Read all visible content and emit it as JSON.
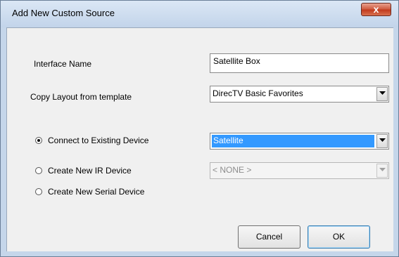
{
  "window": {
    "title": "Add New Custom Source",
    "close_glyph": "x"
  },
  "fields": {
    "interface_name_label": "Interface Name",
    "interface_name_value": "Satellite Box",
    "copy_layout_label": "Copy Layout from template",
    "copy_layout_value": "DirecTV Basic Favorites"
  },
  "options": {
    "connect_existing_label": "Connect to Existing Device",
    "connect_existing_value": "Satellite",
    "create_ir_label": "Create New IR Device",
    "create_ir_value": "< NONE >",
    "create_serial_label": "Create New Serial Device",
    "selected": "connect_existing"
  },
  "buttons": {
    "cancel": "Cancel",
    "ok": "OK"
  },
  "colors": {
    "selection": "#3399ff",
    "close": "#c1391c"
  }
}
